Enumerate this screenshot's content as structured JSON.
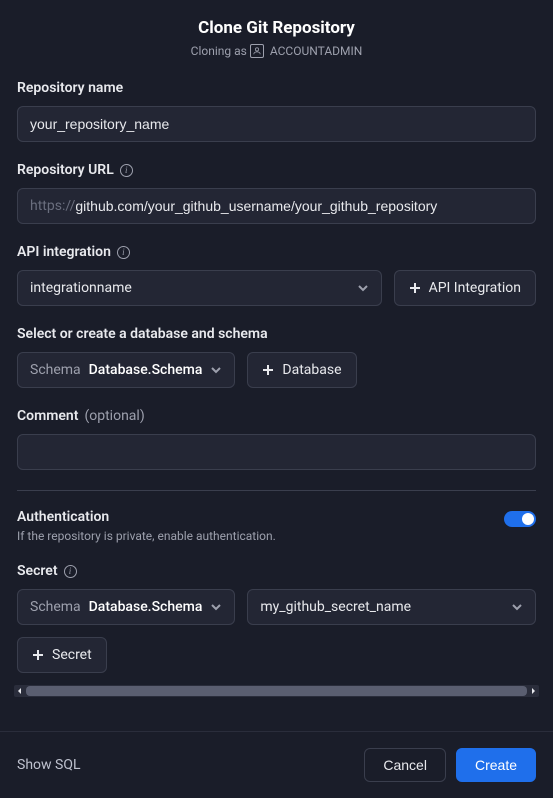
{
  "header": {
    "title": "Clone Git Repository",
    "cloning_as": "Cloning as",
    "role": "ACCOUNTADMIN"
  },
  "repo_name": {
    "label": "Repository name",
    "value": "your_repository_name"
  },
  "repo_url": {
    "label": "Repository URL",
    "prefix": "https://",
    "value": "github.com/your_github_username/your_github_repository"
  },
  "api_integration": {
    "label": "API integration",
    "selected": "integrationname",
    "add_button": "API Integration"
  },
  "db_schema": {
    "label": "Select or create a database and schema",
    "schema_prefix": "Schema",
    "schema_value": "Database.Schema",
    "add_button": "Database"
  },
  "comment": {
    "label": "Comment",
    "optional": "(optional)",
    "value": ""
  },
  "auth": {
    "title": "Authentication",
    "subtitle": "If the repository is private, enable authentication.",
    "enabled": true
  },
  "secret": {
    "label": "Secret",
    "schema_prefix": "Schema",
    "schema_value": "Database.Schema",
    "selected": "my_github_secret_name",
    "add_button": "Secret"
  },
  "footer": {
    "show_sql": "Show SQL",
    "cancel": "Cancel",
    "create": "Create"
  }
}
